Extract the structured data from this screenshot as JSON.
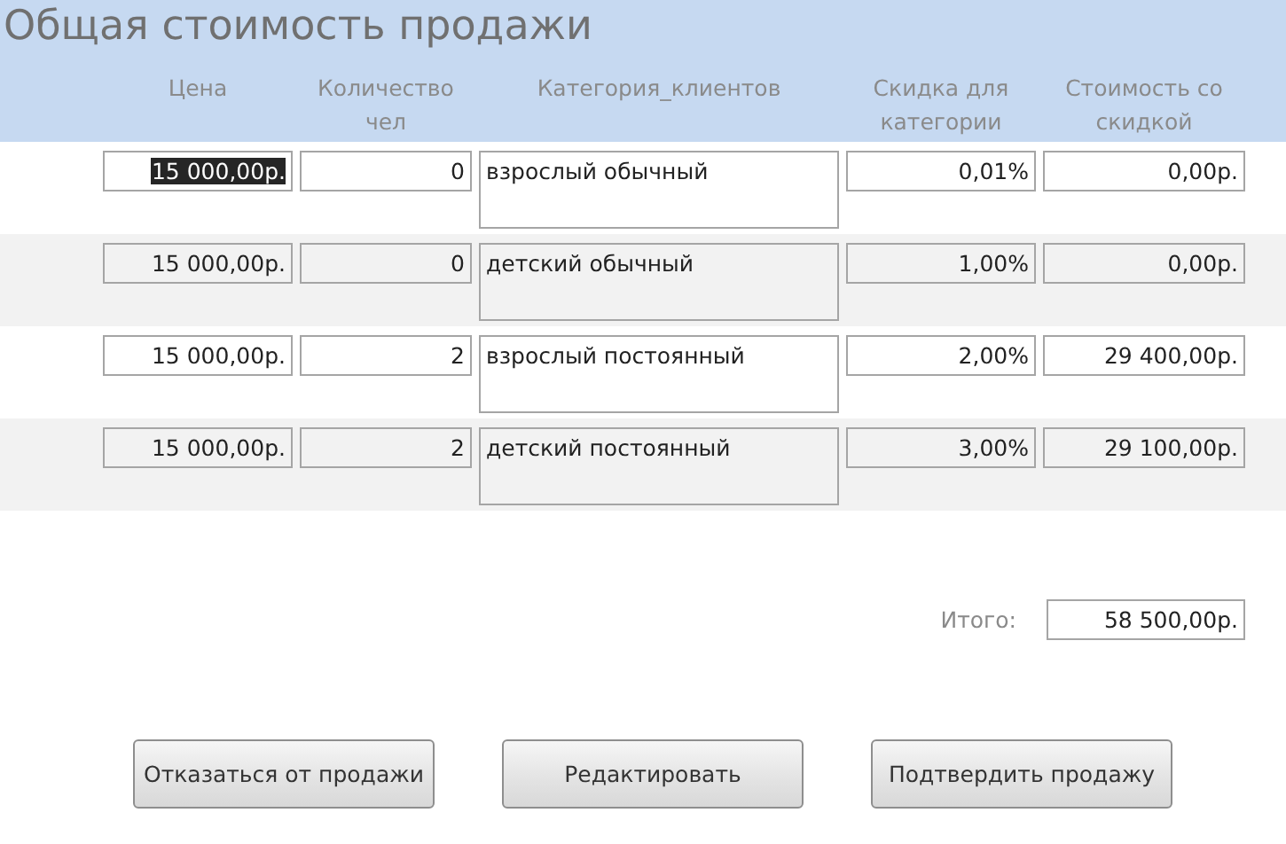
{
  "title": "Общая стоимость продажи",
  "columns": [
    "Цена",
    "Количество чел",
    "Категория_клиентов",
    "Скидка для категории",
    "Стоимость со скидкой"
  ],
  "rows": [
    {
      "price": "15 000,00р.",
      "price_focused": true,
      "count": "0",
      "category": "взрослый обычный",
      "discount": "0,01%",
      "cost": "0,00р."
    },
    {
      "price": "15 000,00р.",
      "price_focused": false,
      "count": "0",
      "category": "детский обычный",
      "discount": "1,00%",
      "cost": "0,00р."
    },
    {
      "price": "15 000,00р.",
      "price_focused": false,
      "count": "2",
      "category": "взрослый постоянный",
      "discount": "2,00%",
      "cost": "29 400,00р."
    },
    {
      "price": "15 000,00р.",
      "price_focused": false,
      "count": "2",
      "category": "детский постоянный",
      "discount": "3,00%",
      "cost": "29 100,00р."
    }
  ],
  "total": {
    "label": "Итого:",
    "value": "58 500,00р."
  },
  "buttons": [
    "Отказаться от продажи",
    "Редактировать",
    "Подтвердить продажу"
  ]
}
